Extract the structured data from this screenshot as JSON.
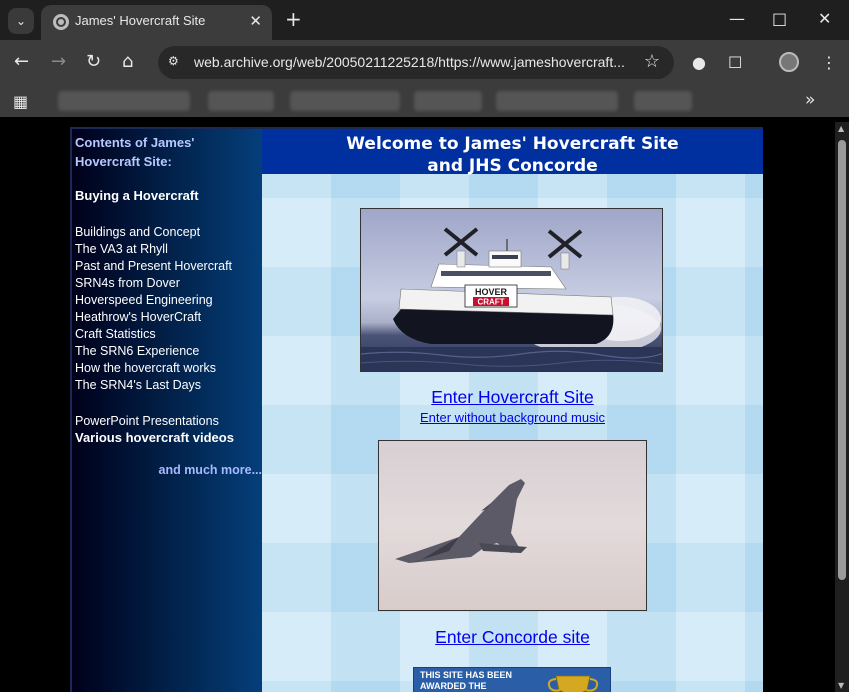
{
  "browser": {
    "tab_title": "James' Hovercraft Site",
    "url": "web.archive.org/web/20050211225218/https://www.jameshovercraft...",
    "icons": [
      "tab-search-icon",
      "globe-icon",
      "close-icon",
      "plus-icon",
      "minimize-icon",
      "maximize-icon",
      "close-window-icon",
      "back-icon",
      "forward-icon",
      "reload-icon",
      "home-icon",
      "site-info-icon",
      "star-icon",
      "extensions-icon",
      "puzzle-icon",
      "menu-icon",
      "apps-icon",
      "chevron-right-icon"
    ]
  },
  "sidebar": {
    "heading": "Contents of James' Hovercraft Site:",
    "items": [
      {
        "label": "Buying a Hovercraft",
        "bold": true
      },
      {
        "label": "Buildings and Concept",
        "bold": false
      },
      {
        "label": "The VA3 at Rhyll",
        "bold": false
      },
      {
        "label": "Past and Present Hovercraft",
        "bold": false
      },
      {
        "label": "SRN4s from Dover",
        "bold": false
      },
      {
        "label": "Hoverspeed Engineering",
        "bold": false
      },
      {
        "label": "Heathrow's HoverCraft",
        "bold": false
      },
      {
        "label": "Craft Statistics",
        "bold": false
      },
      {
        "label": "The SRN6 Experience",
        "bold": false
      },
      {
        "label": "How the hovercraft works",
        "bold": false
      },
      {
        "label": "The SRN4's Last Days",
        "bold": false
      },
      {
        "label": "PowerPoint Presentations",
        "bold": false
      },
      {
        "label": "Various hovercraft videos",
        "bold": true
      }
    ],
    "more": "and much more..."
  },
  "main": {
    "banner_line1": "Welcome to James' Hovercraft Site",
    "banner_line2": "and JHS Concorde",
    "hover_photo_text_top": "HOVER",
    "hover_photo_text_bottom": "CRAFT",
    "enter_hovercraft": "Enter Hovercraft Site",
    "enter_no_music": "Enter without background music",
    "enter_concorde": "Enter Concorde site",
    "award_line1": "THIS SITE HAS BEEN",
    "award_line2": "AWARDED THE"
  }
}
